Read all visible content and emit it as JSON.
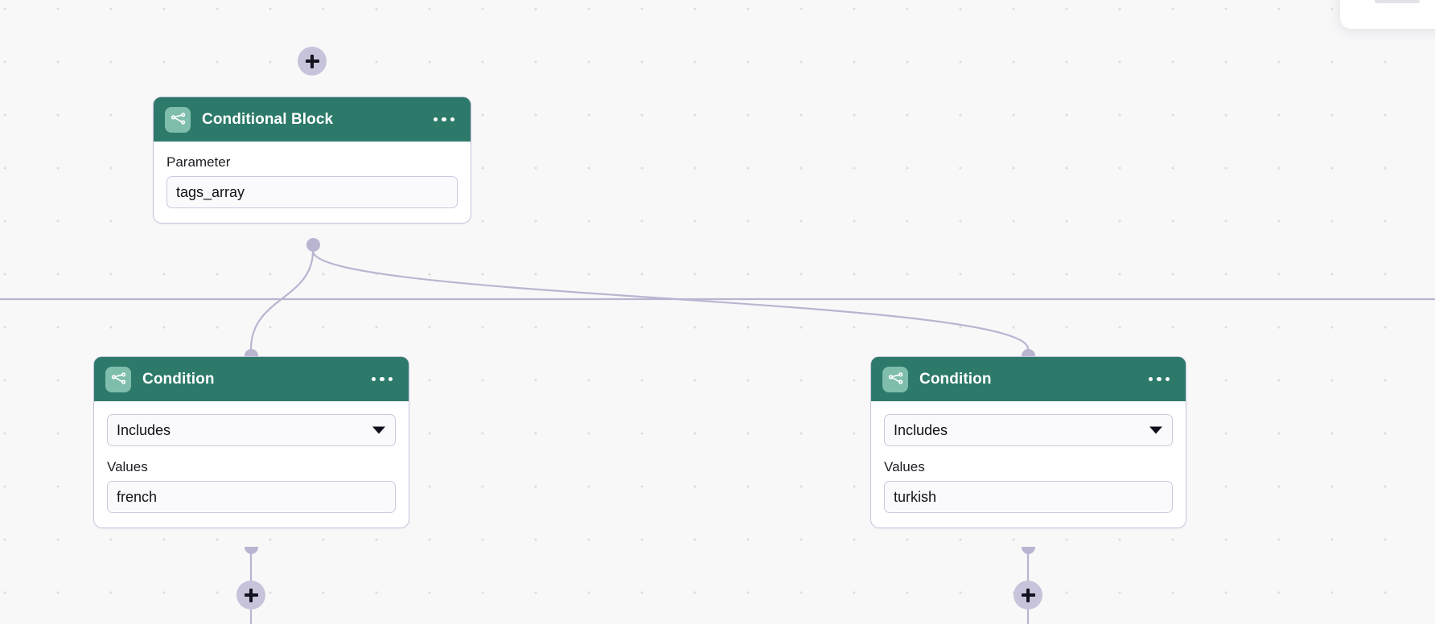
{
  "canvas": {
    "background_color": "#f8f8f9",
    "grid_dot_color": "#dedede",
    "edge_color": "#b9b5d1",
    "divider_color": "#b9b5d1",
    "accent_header_color": "#2d7a6a",
    "icon_tile_color": "#7fbdad",
    "node_border_color": "#c7c3dd",
    "plus_button_color": "#c6c3da"
  },
  "nodes": [
    {
      "id": "conditional-block",
      "title": "Conditional Block",
      "icon": "branch-icon",
      "menu": "more-options",
      "fields": [
        {
          "label": "Parameter",
          "type": "text",
          "value": "tags_array"
        }
      ]
    },
    {
      "id": "condition-left",
      "title": "Condition",
      "icon": "branch-icon",
      "menu": "more-options",
      "fields": [
        {
          "label": "",
          "type": "select",
          "value": "Includes"
        },
        {
          "label": "Values",
          "type": "text",
          "value": "french"
        }
      ]
    },
    {
      "id": "condition-right",
      "title": "Condition",
      "icon": "branch-icon",
      "menu": "more-options",
      "fields": [
        {
          "label": "",
          "type": "select",
          "value": "Includes"
        },
        {
          "label": "Values",
          "type": "text",
          "value": "turkish"
        }
      ]
    }
  ],
  "buttons": {
    "add_top": "+",
    "add_below_left": "+",
    "add_below_right": "+"
  }
}
